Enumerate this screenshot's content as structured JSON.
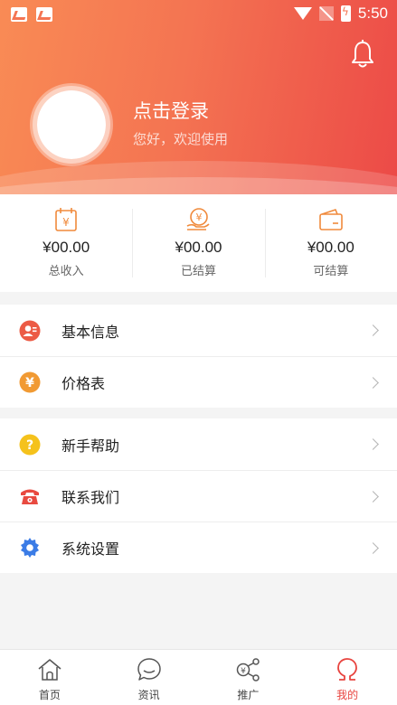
{
  "statusbar": {
    "time": "5:50"
  },
  "profile": {
    "login_title": "点击登录",
    "login_subtitle": "您好，欢迎使用"
  },
  "stats": [
    {
      "icon": "calendar-yen-icon",
      "value": "¥00.00",
      "label": "总收入"
    },
    {
      "icon": "hand-coin-icon",
      "value": "¥00.00",
      "label": "已结算"
    },
    {
      "icon": "wallet-icon",
      "value": "¥00.00",
      "label": "可结算"
    }
  ],
  "menu_group_1": [
    {
      "icon": "user-info-icon",
      "label": "基本信息"
    },
    {
      "icon": "yen-coin-icon",
      "label": "价格表"
    }
  ],
  "menu_group_2": [
    {
      "icon": "help-icon",
      "label": "新手帮助"
    },
    {
      "icon": "phone-icon",
      "label": "联系我们"
    },
    {
      "icon": "settings-gear-icon",
      "label": "系统设置"
    }
  ],
  "tabs": [
    {
      "icon": "home-icon",
      "label": "首页",
      "active": false
    },
    {
      "icon": "chat-icon",
      "label": "资讯",
      "active": false
    },
    {
      "icon": "share-icon",
      "label": "推广",
      "active": false
    },
    {
      "icon": "omega-icon",
      "label": "我的",
      "active": true
    }
  ],
  "colors": {
    "accent": "#e8443f",
    "header_start": "#f98b55",
    "header_end": "#ec4a47",
    "icon_orange": "#f08a3c",
    "icon_yellow": "#f5b81c",
    "icon_blue": "#3b7ce6"
  }
}
